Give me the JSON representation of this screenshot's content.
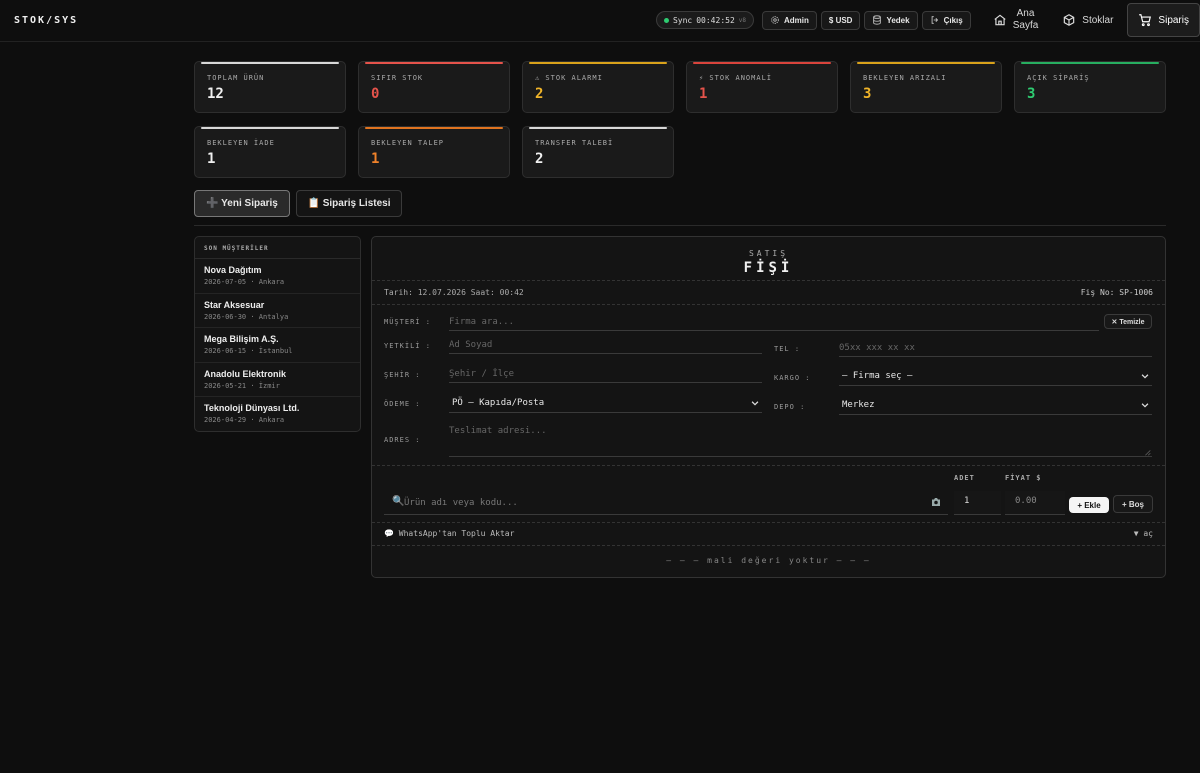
{
  "brand": "STOK/SYS",
  "topbar": {
    "sync_label": "Sync",
    "sync_time": "00:42:52",
    "sync_version": "v8",
    "admin_label": "Admin",
    "currency_label": "$ USD",
    "backup_label": "Yedek",
    "logout_label": "Çıkış",
    "nav": [
      {
        "line1": "Ana",
        "line2": "Sayfa"
      },
      {
        "label": "Stoklar"
      },
      {
        "label": "Sipariş"
      }
    ]
  },
  "stats": [
    {
      "label": "TOPLAM ÜRÜN",
      "value": "12",
      "color": "#f0f0f0",
      "bar": "#d8d8d8"
    },
    {
      "label": "SIFIR STOK",
      "value": "0",
      "color": "#e5534b",
      "bar": "#e5534b"
    },
    {
      "label": "⚠ STOK ALARMI",
      "value": "2",
      "color": "#f0b429",
      "bar": "#d9a21b"
    },
    {
      "label": "⚡ STOK ANOMALİ",
      "value": "1",
      "color": "#e5534b",
      "bar": "#d9443c"
    },
    {
      "label": "BEKLEYEN ARIZALI",
      "value": "3",
      "color": "#f0b429",
      "bar": "#d9a21b"
    },
    {
      "label": "AÇIK SİPARİŞ",
      "value": "3",
      "color": "#2ecc71",
      "bar": "#27ae60"
    },
    {
      "label": "BEKLEYEN İADE",
      "value": "1",
      "color": "#f0f0f0",
      "bar": "#d8d8d8"
    },
    {
      "label": "BEKLEYEN TALEP",
      "value": "1",
      "color": "#f0822a",
      "bar": "#e07420"
    },
    {
      "label": "TRANSFER TALEBİ",
      "value": "2",
      "color": "#f0f0f0",
      "bar": "#d8d8d8"
    }
  ],
  "actions": {
    "new_order": "➕ Yeni Sipariş",
    "order_list": "📋 Sipariş Listesi"
  },
  "customers": {
    "title": "SON MÜŞTERİLER",
    "items": [
      {
        "name": "Nova Dağıtım",
        "meta": "2026-07-05 · Ankara"
      },
      {
        "name": "Star Aksesuar",
        "meta": "2026-06-30 · Antalya"
      },
      {
        "name": "Mega Bilişim A.Ş.",
        "meta": "2026-06-15 · İstanbul"
      },
      {
        "name": "Anadolu Elektronik",
        "meta": "2026-05-21 · İzmir"
      },
      {
        "name": "Teknoloji Dünyası Ltd.",
        "meta": "2026-04-29 · Ankara"
      }
    ]
  },
  "receipt": {
    "kicker": "SATIŞ",
    "title": "FİŞİ",
    "date_label": "Tarih:",
    "date": "12.07.2026",
    "time_label": "Saat:",
    "time": "00:42",
    "no_label": "Fiş No:",
    "no": "SP-1006",
    "fields": {
      "customer_label": "MÜŞTERİ :",
      "customer_placeholder": "Firma ara...",
      "clear_label": "✕ Temizle",
      "contact_label": "YETKİLİ :",
      "contact_placeholder": "Ad Soyad",
      "phone_label": "TEL :",
      "phone_placeholder": "05xx xxx xx xx",
      "city_label": "ŞEHİR :",
      "city_placeholder": "Şehir / İlçe",
      "cargo_label": "KARGO :",
      "cargo_value": "— Firma seç —",
      "payment_label": "ÖDEME :",
      "payment_value": "PÖ — Kapıda/Posta",
      "depot_label": "DEPO :",
      "depot_value": "Merkez",
      "address_label": "ADRES :",
      "address_placeholder": "Teslimat adresi..."
    },
    "product": {
      "qty_header": "ADET",
      "price_header": "FİYAT $",
      "search_placeholder": "Ürün adı veya kodu...",
      "qty_value": "1",
      "price_value": "0.00",
      "add_label": "+ Ekle",
      "empty_label": "+ Boş"
    },
    "whatsapp_label": "WhatsApp'tan Toplu Aktar",
    "whatsapp_toggle": "▼ aç",
    "empty_note": "— — — mali değeri yoktur — — —"
  }
}
